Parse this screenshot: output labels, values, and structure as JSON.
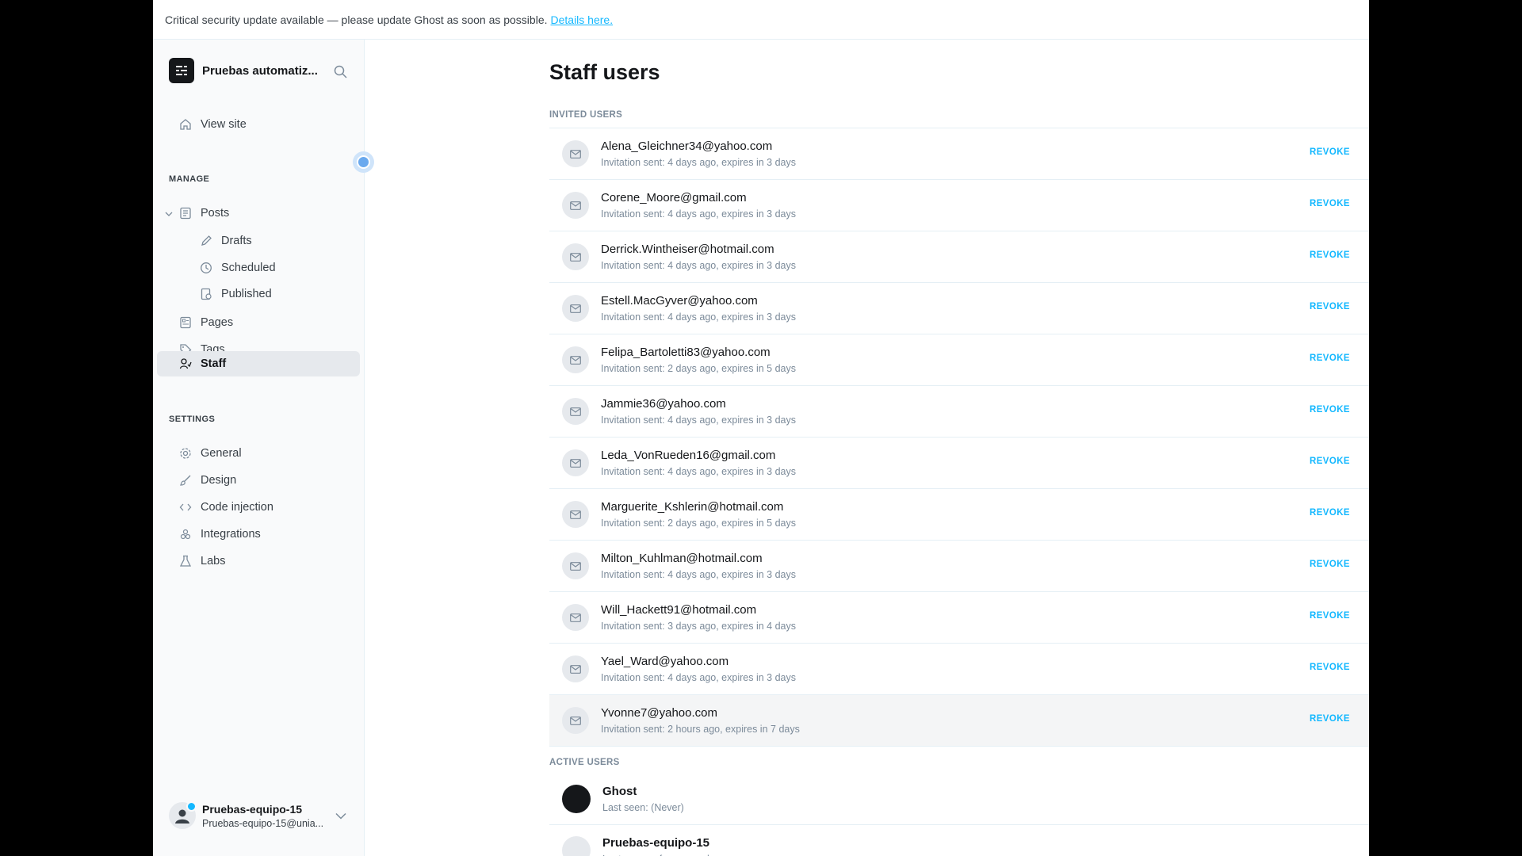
{
  "banner": {
    "text": "Critical security update available — please update Ghost as soon as possible.",
    "link": "Details here."
  },
  "sidebar": {
    "brand": "Pruebas automatiz...",
    "view_site": "View site",
    "manage_label": "MANAGE",
    "posts": "Posts",
    "drafts": "Drafts",
    "scheduled": "Scheduled",
    "published": "Published",
    "pages": "Pages",
    "tags": "Tags",
    "staff": "Staff",
    "settings_label": "SETTINGS",
    "general": "General",
    "design": "Design",
    "code_injection": "Code injection",
    "integrations": "Integrations",
    "labs": "Labs",
    "user_name": "Pruebas-equipo-15",
    "user_email": "Pruebas-equipo-15@unia..."
  },
  "main": {
    "title": "Staff users",
    "invited_label": "INVITED USERS",
    "revoke_label": "REVOKE",
    "active_label": "ACTIVE USERS",
    "invited": [
      {
        "email": "Alena_Gleichner34@yahoo.com",
        "meta": "Invitation sent: 4 days ago, expires in 3 days"
      },
      {
        "email": "Corene_Moore@gmail.com",
        "meta": "Invitation sent: 4 days ago, expires in 3 days"
      },
      {
        "email": "Derrick.Wintheiser@hotmail.com",
        "meta": "Invitation sent: 4 days ago, expires in 3 days"
      },
      {
        "email": "Estell.MacGyver@yahoo.com",
        "meta": "Invitation sent: 4 days ago, expires in 3 days"
      },
      {
        "email": "Felipa_Bartoletti83@yahoo.com",
        "meta": "Invitation sent: 2 days ago, expires in 5 days"
      },
      {
        "email": "Jammie36@yahoo.com",
        "meta": "Invitation sent: 4 days ago, expires in 3 days"
      },
      {
        "email": "Leda_VonRueden16@gmail.com",
        "meta": "Invitation sent: 4 days ago, expires in 3 days"
      },
      {
        "email": "Marguerite_Kshlerin@hotmail.com",
        "meta": "Invitation sent: 2 days ago, expires in 5 days"
      },
      {
        "email": "Milton_Kuhlman@hotmail.com",
        "meta": "Invitation sent: 4 days ago, expires in 3 days"
      },
      {
        "email": "Will_Hackett91@hotmail.com",
        "meta": "Invitation sent: 3 days ago, expires in 4 days"
      },
      {
        "email": "Yael_Ward@yahoo.com",
        "meta": "Invitation sent: 4 days ago, expires in 3 days"
      },
      {
        "email": "Yvonne7@yahoo.com",
        "meta": "Invitation sent: 2 hours ago, expires in 7 days"
      }
    ],
    "active": [
      {
        "name": "Ghost",
        "meta": "Last seen: (Never)"
      },
      {
        "name": "Pruebas-equipo-15",
        "meta": "Last seen: a few seconds ago"
      }
    ]
  }
}
